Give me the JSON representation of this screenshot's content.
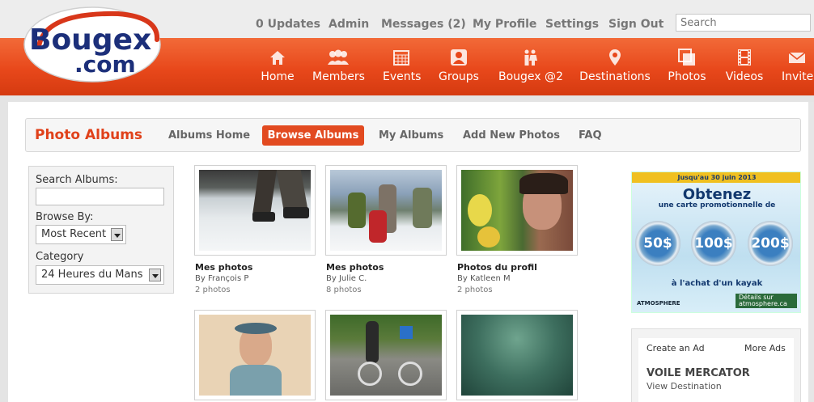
{
  "top_links": {
    "updates": "0 Updates",
    "admin": "Admin",
    "messages": "Messages (2)",
    "profile": "My Profile",
    "settings": "Settings",
    "signout": "Sign Out"
  },
  "search": {
    "placeholder": "Search"
  },
  "logo": {
    "line1": "Bougex",
    "line2": ".com"
  },
  "nav": [
    {
      "label": "Home",
      "icon": "home-icon"
    },
    {
      "label": "Members",
      "icon": "members-icon"
    },
    {
      "label": "Events",
      "icon": "calendar-icon"
    },
    {
      "label": "Groups",
      "icon": "groups-icon"
    },
    {
      "label": "Bougex @2",
      "icon": "couple-icon"
    },
    {
      "label": "Destinations",
      "icon": "map-pin-icon"
    },
    {
      "label": "Photos",
      "icon": "photos-icon"
    },
    {
      "label": "Videos",
      "icon": "film-icon"
    },
    {
      "label": "Invite",
      "icon": "envelope-icon"
    }
  ],
  "subnav": {
    "title": "Photo Albums",
    "albums_home": "Albums Home",
    "browse_albums": "Browse Albums",
    "my_albums": "My Albums",
    "add_new_photos": "Add New Photos",
    "faq": "FAQ"
  },
  "filters": {
    "search_label": "Search Albums:",
    "browse_label": "Browse By:",
    "browse_value": "Most Recent",
    "category_label": "Category",
    "category_value": "24 Heures du Mans"
  },
  "albums": [
    {
      "title": "Mes photos",
      "by": "By François P",
      "count": "2 photos"
    },
    {
      "title": "Mes photos",
      "by": "By Julie C.",
      "count": "8 photos"
    },
    {
      "title": "Photos du profil",
      "by": "By Katleen M",
      "count": "2 photos"
    }
  ],
  "ad": {
    "top": "Jusqu'au 30 juin 2013",
    "headline": "Obtenez",
    "subline": "une carte promotionnelle de",
    "amounts": [
      "50$",
      "100$",
      "200$"
    ],
    "bottom": "à l'achat d'un kayak",
    "brand": "ATMOSPHERE",
    "cta": "Détails sur atmosphere.ca"
  },
  "ad_links": {
    "create": "Create an Ad",
    "more": "More Ads"
  },
  "featured_ad": {
    "title": "VOILE MERCATOR",
    "sub": "View Destination"
  },
  "colors": {
    "brand_orange": "#e8481b",
    "topbar": "#ededed",
    "link_gray": "#777777"
  }
}
